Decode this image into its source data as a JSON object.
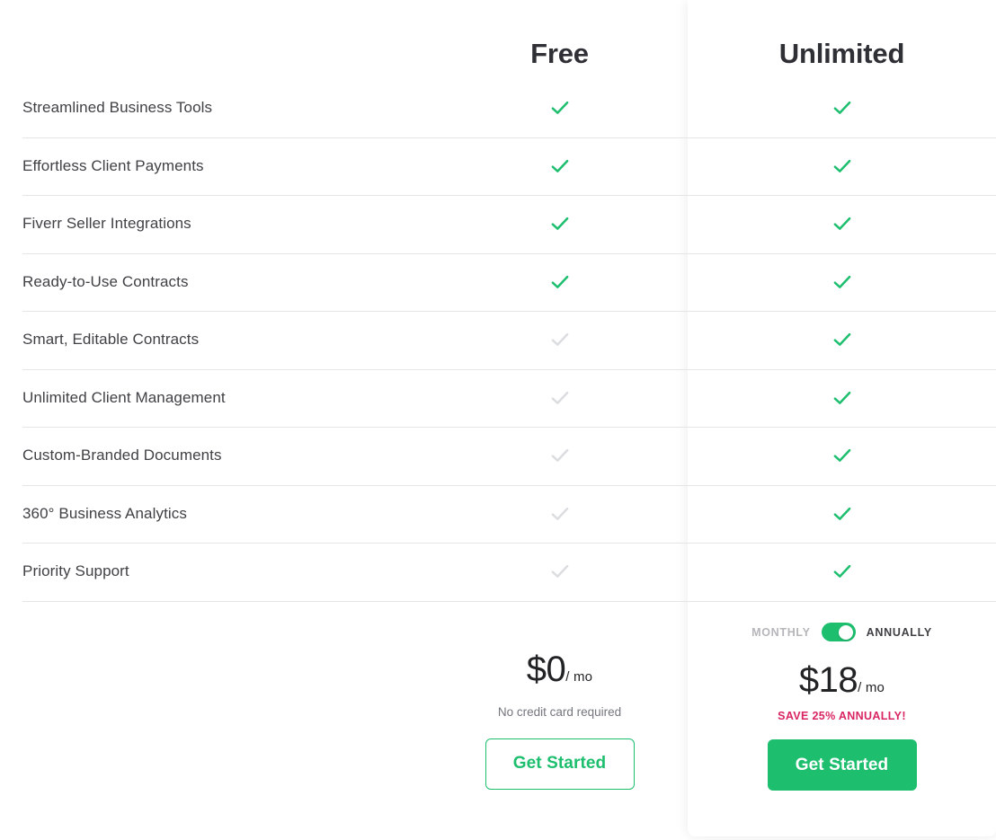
{
  "table": {
    "columns": [
      {
        "key": "feature",
        "label": ""
      },
      {
        "key": "free",
        "label": "Free"
      },
      {
        "key": "unlimited",
        "label": "Unlimited"
      }
    ],
    "rows": [
      {
        "feature": "Streamlined Business Tools",
        "free": "check-on",
        "unlimited": "check-on"
      },
      {
        "feature": "Effortless Client Payments",
        "free": "check-on",
        "unlimited": "check-on"
      },
      {
        "feature": "Fiverr Seller Integrations",
        "free": "check-on",
        "unlimited": "check-on"
      },
      {
        "feature": "Ready-to-Use Contracts",
        "free": "check-on",
        "unlimited": "check-on"
      },
      {
        "feature": "Smart, Editable Contracts",
        "free": "check-off",
        "unlimited": "check-on"
      },
      {
        "feature": "Unlimited Client Management",
        "free": "check-off",
        "unlimited": "check-on"
      },
      {
        "feature": "Custom-Branded Documents",
        "free": "check-off",
        "unlimited": "check-on"
      },
      {
        "feature": "360° Business Analytics",
        "free": "check-off",
        "unlimited": "check-on"
      },
      {
        "feature": "Priority Support",
        "free": "check-off",
        "unlimited": "check-on"
      }
    ]
  },
  "free_plan": {
    "name": "Free",
    "price_amount": "$0",
    "price_period": "/ mo",
    "note": "No credit card required",
    "cta_label": "Get Started"
  },
  "unlimited_plan": {
    "name": "Unlimited",
    "billing_toggle": {
      "left_label": "MONTHLY",
      "right_label": "ANNUALLY",
      "selected": "ANNUALLY",
      "state": "on"
    },
    "price_amount": "$18",
    "price_period": "/ mo",
    "note": "SAVE 25% ANNUALLY!",
    "cta_label": "Get Started"
  },
  "colors": {
    "brand_green": "#1dbf6f",
    "save_pink": "#d92662",
    "text_dark": "#404145",
    "text_muted": "#74767e",
    "check_disabled": "#dcdde0",
    "divider": "#e4e5e7"
  }
}
